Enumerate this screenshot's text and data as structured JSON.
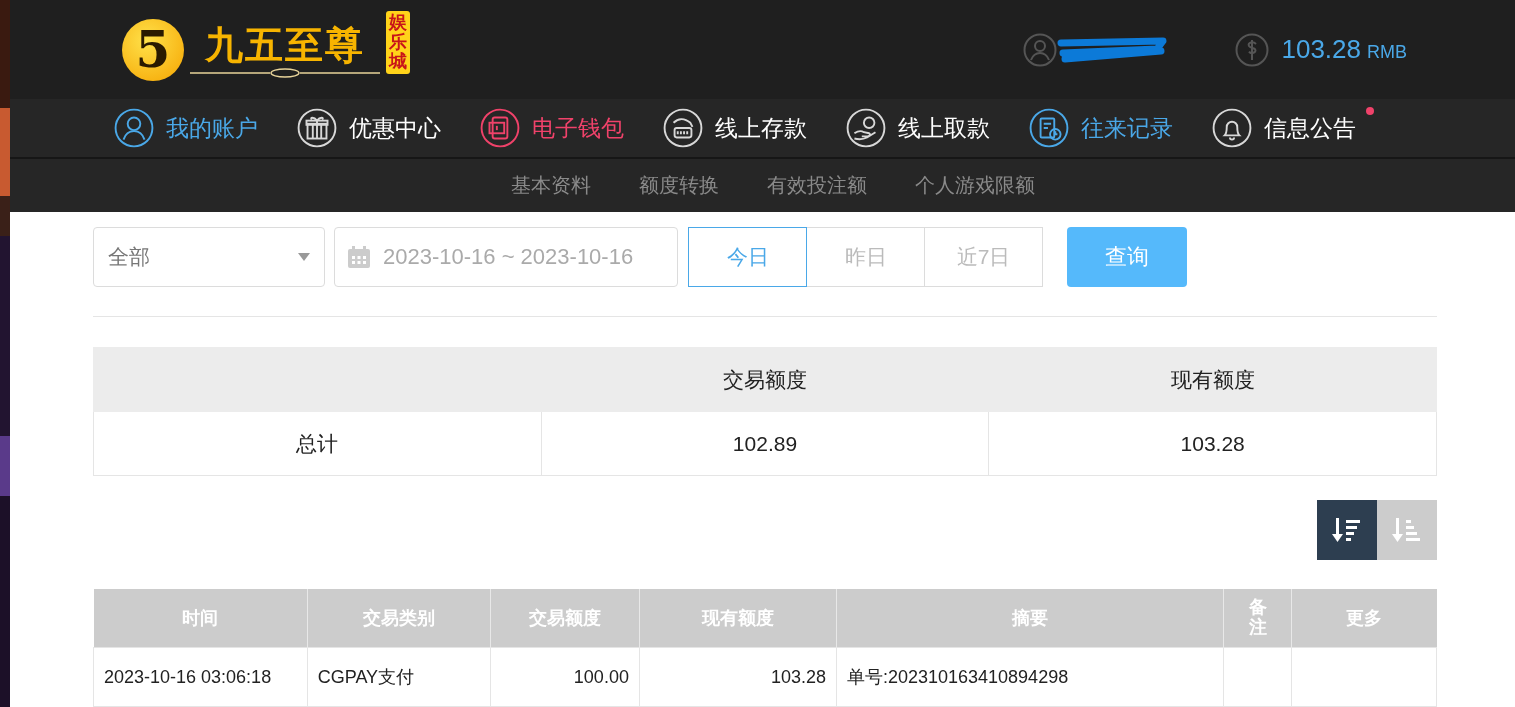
{
  "header": {
    "logo": {
      "mark": "5",
      "name": "九五至尊",
      "badge": "娱乐城"
    },
    "balance": {
      "amount": "103.28",
      "currency": "RMB"
    }
  },
  "nav": [
    {
      "label": "我的账户",
      "kind": "user",
      "color": "#4aa8e8",
      "badge": false
    },
    {
      "label": "优惠中心",
      "kind": "gift",
      "color": "#ffffff",
      "badge": false
    },
    {
      "label": "电子钱包",
      "kind": "wallet",
      "color": "#f0426a",
      "badge": false
    },
    {
      "label": "线上存款",
      "kind": "deposit",
      "color": "#ffffff",
      "badge": false
    },
    {
      "label": "线上取款",
      "kind": "withdraw",
      "color": "#ffffff",
      "badge": false
    },
    {
      "label": "往来记录",
      "kind": "record",
      "color": "#4aa8e8",
      "badge": false
    },
    {
      "label": "信息公告",
      "kind": "bell",
      "color": "#ffffff",
      "badge": true
    }
  ],
  "subnav": [
    {
      "label": "基本资料"
    },
    {
      "label": "额度转换"
    },
    {
      "label": "有效投注额"
    },
    {
      "label": "个人游戏限额"
    }
  ],
  "filters": {
    "type_select": {
      "value": "全部"
    },
    "date_range": {
      "value": "2023-10-16 ~ 2023-10-16"
    },
    "quick_ranges": [
      {
        "label": "今日",
        "selected": true
      },
      {
        "label": "昨日",
        "selected": false
      },
      {
        "label": "近7日",
        "selected": false
      }
    ],
    "query_button": "查询"
  },
  "summary": {
    "columns": [
      "交易额度",
      "现有额度"
    ],
    "rows": [
      {
        "label": "总计",
        "cells": [
          "102.89",
          "103.28"
        ]
      }
    ]
  },
  "sort_buttons": [
    {
      "kind": "desc",
      "selected": true
    },
    {
      "kind": "asc",
      "selected": false
    }
  ],
  "records": {
    "columns": [
      "时间",
      "交易类别",
      "交易额度",
      "现有额度",
      "摘要",
      "备注",
      "更多"
    ],
    "rows": [
      {
        "cells": [
          "2023-10-16 03:06:18",
          "CGPAY支付",
          "100.00",
          "103.28",
          "单号:202310163410894298"
        ]
      }
    ]
  }
}
